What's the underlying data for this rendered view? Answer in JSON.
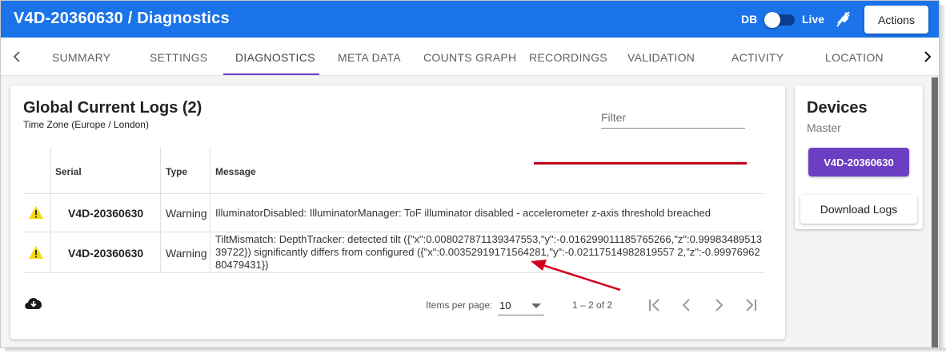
{
  "header": {
    "title": "V4D-20360630 / Diagnostics",
    "db_label": "DB",
    "live_label": "Live",
    "toggle_state": "off",
    "actions_label": "Actions",
    "color": "#1a73e8"
  },
  "tabs": {
    "items": [
      {
        "label": "SUMMARY",
        "active": false
      },
      {
        "label": "SETTINGS",
        "active": false
      },
      {
        "label": "DIAGNOSTICS",
        "active": true
      },
      {
        "label": "META DATA",
        "active": false
      },
      {
        "label": "COUNTS GRAPH",
        "active": false
      },
      {
        "label": "RECORDINGS",
        "active": false
      },
      {
        "label": "VALIDATION",
        "active": false
      },
      {
        "label": "ACTIVITY",
        "active": false
      },
      {
        "label": "LOCATION",
        "active": false
      }
    ],
    "ink_color": "#6a3fc2"
  },
  "logs": {
    "title": "Global Current Logs (2)",
    "subtitle": "Time Zone (Europe / London)",
    "filter_placeholder": "Filter",
    "columns": [
      "",
      "Serial",
      "Type",
      "Message"
    ],
    "rows": [
      {
        "icon": "warning-icon",
        "serial": "V4D-20360630",
        "type": "Warning",
        "message": "IlluminatorDisabled: IlluminatorManager: ToF illuminator disabled - accelerometer z-axis threshold breached"
      },
      {
        "icon": "warning-icon",
        "serial": "V4D-20360630",
        "type": "Warning",
        "message": "TiltMismatch: DepthTracker: detected tilt ({\"x\":0.008027871139347553,\"y\":-0.016299011185765266,\"z\":0.9998348951339722}) significantly differs from configured ({\"x\":0.00352919171564281,\"y\":-0.02117514982819557 2,\"z\":-0.9997696280479431})"
      }
    ],
    "items_per_page_label": "Items per page:",
    "items_per_page_value": "10",
    "range_label": "1 – 2 of 2",
    "warning_color": "#f5d90a",
    "annotation_color": "#c0001e"
  },
  "devices": {
    "title": "Devices",
    "subtitle": "Master",
    "device_button": "V4D-20360630",
    "download_button": "Download Logs"
  }
}
